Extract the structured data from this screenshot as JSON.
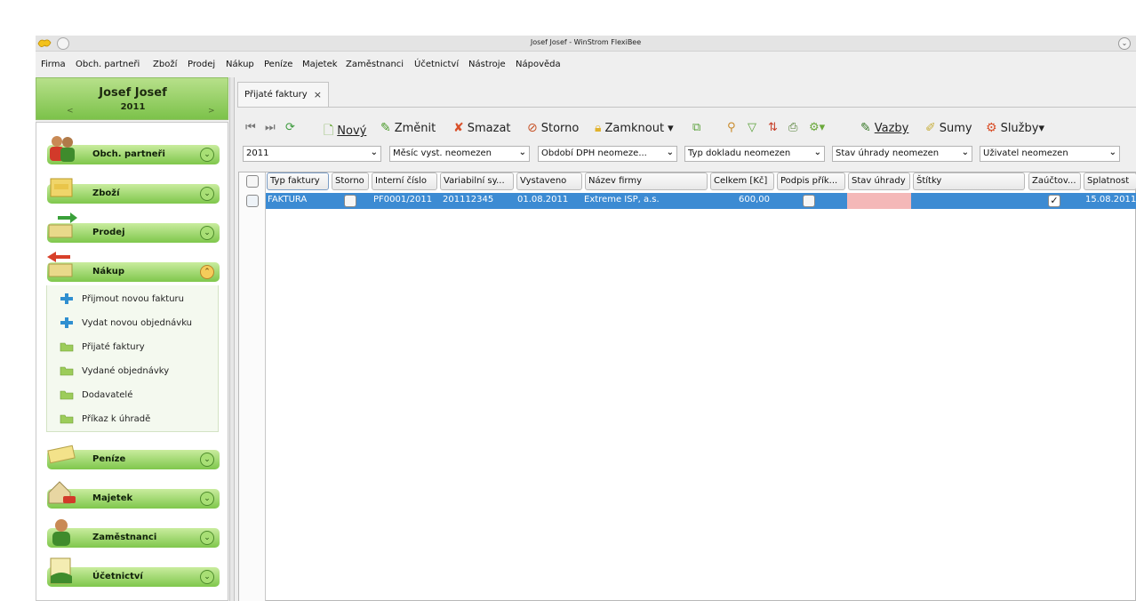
{
  "window": {
    "title": "Josef Josef - WinStrom FlexiBee"
  },
  "menu": [
    "Firma",
    "Obch. partneři",
    "Zboží",
    "Prodej",
    "Nákup",
    "Peníze",
    "Majetek",
    "Zaměstnanci",
    "Účetnictví",
    "Nástroje",
    "Nápověda"
  ],
  "company": {
    "name": "Josef Josef",
    "year": "2011"
  },
  "sidebar": {
    "sections": [
      {
        "label": "Obch. partneři"
      },
      {
        "label": "Zboží"
      },
      {
        "label": "Prodej"
      },
      {
        "label": "Nákup"
      },
      {
        "label": "Peníze"
      },
      {
        "label": "Majetek"
      },
      {
        "label": "Zaměstnanci"
      },
      {
        "label": "Účetnictví"
      }
    ],
    "nakup_items": [
      {
        "label": "Přijmout novou fakturu",
        "icon": "plus-icon"
      },
      {
        "label": "Vydat novou objednávku",
        "icon": "plus-icon"
      },
      {
        "label": "Přijaté faktury",
        "icon": "folder-icon"
      },
      {
        "label": "Vydané objednávky",
        "icon": "folder-icon"
      },
      {
        "label": "Dodavatelé",
        "icon": "folder-icon"
      },
      {
        "label": "Příkaz k úhradě",
        "icon": "folder-icon"
      }
    ]
  },
  "tab": {
    "label": "Přijaté faktury",
    "close": "×"
  },
  "toolbar": {
    "new": "Nový",
    "edit": "Změnit",
    "delete": "Smazat",
    "storno": "Storno",
    "lock": "Zamknout",
    "links": "Vazby",
    "sums": "Sumy",
    "services": "Služby"
  },
  "filters": {
    "year": "2011",
    "month": "Měsíc vyst. neomezen",
    "vat_period": "Období DPH neomeze...",
    "doc_type": "Typ dokladu neomezen",
    "payment_state": "Stav úhrady neomezen",
    "user": "Uživatel neomezen"
  },
  "table": {
    "columns": [
      "Typ faktury",
      "Storno",
      "Interní číslo",
      "Variabilní sy...",
      "Vystaveno",
      "Název firmy",
      "Celkem [Kč]",
      "Podpis přík...",
      "Stav úhrady",
      "Štítky",
      "Zaúčtov...",
      "Splatnost"
    ],
    "rows": [
      {
        "type": "FAKTURA",
        "internal": "PF0001/2011",
        "variable": "201112345",
        "issued": "01.08.2011",
        "company": "Extreme ISP, a.s.",
        "total": "600,00",
        "due": "15.08.2011"
      }
    ]
  },
  "colors": {
    "selection": "#3c8bd3",
    "accent_green": "#7cc24a",
    "unpaid": "#f4b8b8"
  }
}
